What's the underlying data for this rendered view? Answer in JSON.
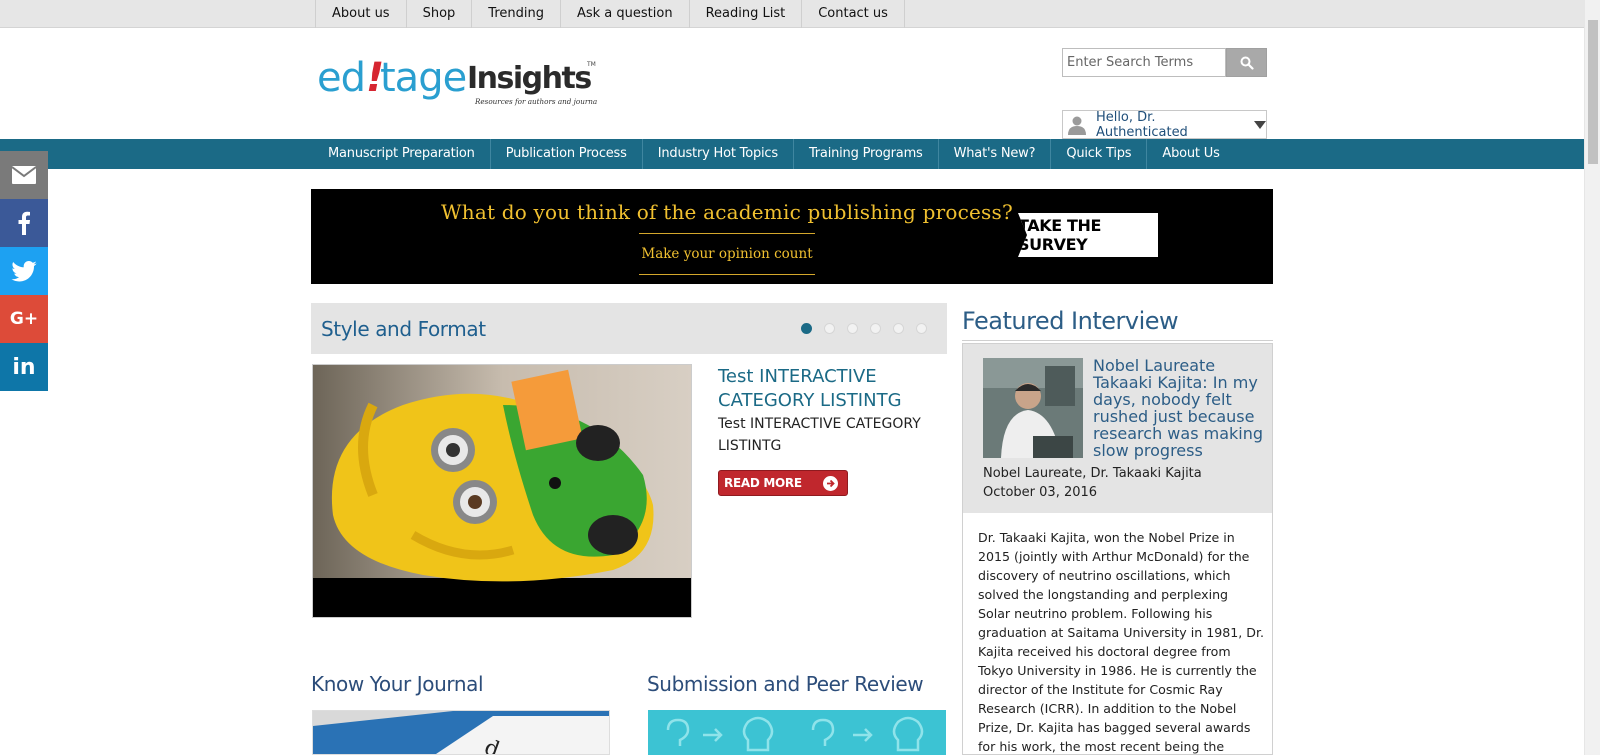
{
  "topbar": {
    "links": [
      "About us",
      "Shop",
      "Trending",
      "Ask a question",
      "Reading List",
      "Contact us"
    ]
  },
  "header": {
    "logo_main": "ed!tage",
    "logo_insights": "Insights",
    "logo_tm": "TM",
    "logo_tagline": "Resources for authors and journals",
    "search_placeholder": "Enter Search Terms",
    "user_greeting": "Hello, Dr. Authenticated"
  },
  "mainnav": {
    "links": [
      "Manuscript Preparation",
      "Publication Process",
      "Industry Hot Topics",
      "Training Programs",
      "What's New?",
      "Quick Tips",
      "About Us"
    ]
  },
  "social": {
    "items": [
      "mail",
      "facebook",
      "twitter",
      "google-plus",
      "linkedin"
    ],
    "gplus_label": "G+",
    "linkedin_label": "in"
  },
  "banner": {
    "question": "What do you think of the academic publishing process?",
    "subtext": "Make your opinion count",
    "button": "TAKE THE SURVEY"
  },
  "carousel": {
    "title": "Style and Format",
    "dot_count": 6,
    "active_dot": 0,
    "slide_title": "Test INTERACTIVE CATEGORY LISTINTG",
    "slide_text": "Test INTERACTIVE CATEGORY LISTINTG",
    "read_more": "READ MORE"
  },
  "sections": {
    "left": "Know Your Journal",
    "right": "Submission and Peer Review"
  },
  "featured": {
    "title": "Featured Interview",
    "headline": "Nobel Laureate Takaaki Kajita: In my days, nobody felt rushed just because research was making slow progress",
    "author": "Nobel Laureate, Dr. Takaaki Kajita",
    "date": "October 03, 2016",
    "body": "Dr. Takaaki Kajita, won the Nobel Prize in 2015 (jointly with Arthur McDonald) for the discovery of neutrino oscillations, which solved the longstanding and perplexing Solar neutrino problem. Following his graduation at Saitama University in 1981, Dr. Kajita received his doctoral degree from Tokyo University in 1986. He is currently the director of the Institute for Cosmic Ray Research (ICRR). In addition to the Nobel Prize, Dr. Kajita has bagged several awards for his work, the most recent being the Special Breakthrough Prize in Fundamental"
  },
  "colors": {
    "nav": "#1b6a86",
    "banner_text": "#f0c030",
    "read_more": "#c0272d",
    "heading": "#2c5d86"
  }
}
